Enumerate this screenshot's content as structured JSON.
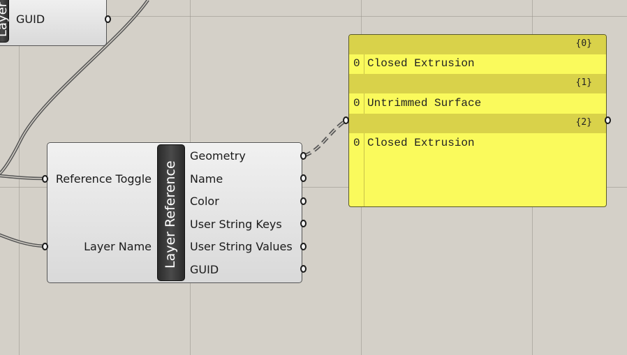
{
  "upper_component": {
    "title_partial": "Layer",
    "outputs": [
      {
        "label": "GUID"
      }
    ]
  },
  "layer_reference": {
    "title": "Layer Reference",
    "inputs": [
      {
        "label": "Reference Toggle"
      },
      {
        "label": "Layer Name"
      }
    ],
    "outputs": [
      {
        "label": "Geometry"
      },
      {
        "label": "Name"
      },
      {
        "label": "Color"
      },
      {
        "label": "User String Keys"
      },
      {
        "label": "User String Values"
      },
      {
        "label": "GUID"
      }
    ]
  },
  "panel": {
    "branches": [
      {
        "path": "{0}",
        "index": "0",
        "value": "Closed Extrusion"
      },
      {
        "path": "{1}",
        "index": "0",
        "value": "Untrimmed Surface"
      },
      {
        "path": "{2}",
        "index": "0",
        "value": "Closed Extrusion"
      }
    ]
  },
  "colors": {
    "canvas": "#d4d0c8",
    "panel": "#fafa5c",
    "panel_header": "#d9d24a",
    "title_strip": "#2b2b2b"
  }
}
